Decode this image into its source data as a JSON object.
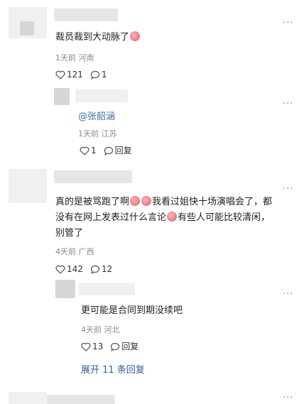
{
  "comments": [
    {
      "text": "裁员裁到大动脉了",
      "emoji_count": 1,
      "time": "1天前",
      "location": "河南",
      "likes": "121",
      "comments": "1"
    },
    {
      "mention": "@张韶涵",
      "time": "1天前",
      "location": "江苏",
      "likes": "1",
      "reply": "回复"
    },
    {
      "line1": "真的是被骂跑了啊",
      "line1b": "我看过姐快十场演唱会了，都",
      "line2": "没有在网上发表过什么言论",
      "line2b": "有些人可能比较清闲，",
      "line3": "别管了",
      "time": "4天前",
      "location": "广西",
      "likes": "142",
      "comments": "12"
    },
    {
      "text": "更可能是合同到期没续吧",
      "time": "4天前",
      "location": "河北",
      "likes": "13",
      "reply": "回复"
    }
  ],
  "expand_replies": "展开 11 条回复",
  "more_label": "···",
  "icons": [
    "heart-icon",
    "comment-icon",
    "more-icon",
    "emoji-icon"
  ]
}
